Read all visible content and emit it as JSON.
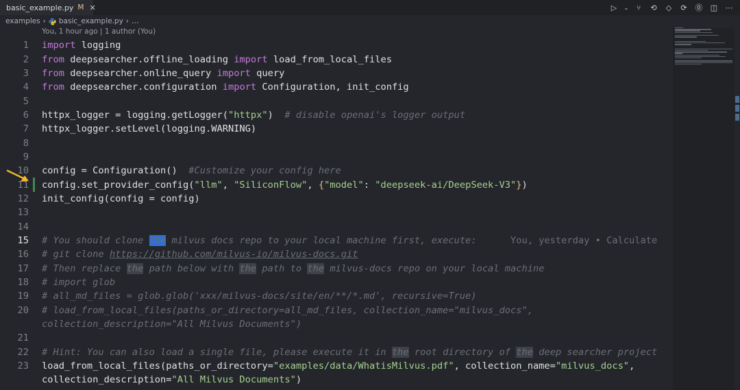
{
  "tab": {
    "filename": "basic_example.py",
    "modified": "M",
    "close": "✕"
  },
  "breadcrumb": {
    "folder": "examples",
    "file": "basic_example.py",
    "ellipsis": "…"
  },
  "blame_header": "You, 1 hour ago | 1 author (You)",
  "code": {
    "lines": [
      {
        "n": "1",
        "tokens": [
          {
            "t": "kw",
            "v": "import"
          },
          {
            "t": "txt",
            "v": " logging"
          }
        ]
      },
      {
        "n": "2",
        "tokens": [
          {
            "t": "kw",
            "v": "from"
          },
          {
            "t": "txt",
            "v": " deepsearcher.offline_loading "
          },
          {
            "t": "kw",
            "v": "import"
          },
          {
            "t": "txt",
            "v": " load_from_local_files"
          }
        ]
      },
      {
        "n": "3",
        "tokens": [
          {
            "t": "kw",
            "v": "from"
          },
          {
            "t": "txt",
            "v": " deepsearcher.online_query "
          },
          {
            "t": "kw",
            "v": "import"
          },
          {
            "t": "txt",
            "v": " query"
          }
        ]
      },
      {
        "n": "4",
        "tokens": [
          {
            "t": "kw",
            "v": "from"
          },
          {
            "t": "txt",
            "v": " deepsearcher.configuration "
          },
          {
            "t": "kw",
            "v": "import"
          },
          {
            "t": "txt",
            "v": " Configuration, init_config"
          }
        ]
      },
      {
        "n": "5",
        "tokens": []
      },
      {
        "n": "6",
        "tokens": [
          {
            "t": "txt",
            "v": "httpx_logger = logging.getLogger("
          },
          {
            "t": "str",
            "v": "\"httpx\""
          },
          {
            "t": "txt",
            "v": ")  "
          },
          {
            "t": "cm",
            "v": "# disable openai's logger output"
          }
        ]
      },
      {
        "n": "7",
        "tokens": [
          {
            "t": "txt",
            "v": "httpx_logger.setLevel(logging.WARNING)"
          }
        ]
      },
      {
        "n": "8",
        "tokens": []
      },
      {
        "n": "9",
        "tokens": []
      },
      {
        "n": "10",
        "tokens": [
          {
            "t": "txt",
            "v": "config = Configuration()  "
          },
          {
            "t": "cm",
            "v": "#Customize your config here"
          }
        ]
      },
      {
        "n": "11",
        "mod": true,
        "tokens": [
          {
            "t": "txt",
            "v": "config.set_provider_config("
          },
          {
            "t": "str",
            "v": "\"llm\""
          },
          {
            "t": "txt",
            "v": ", "
          },
          {
            "t": "str",
            "v": "\"SiliconFlow\""
          },
          {
            "t": "txt",
            "v": ", "
          },
          {
            "t": "brace",
            "v": "{"
          },
          {
            "t": "str",
            "v": "\"model\""
          },
          {
            "t": "txt",
            "v": ": "
          },
          {
            "t": "str",
            "v": "\"deepseek-ai/DeepSeek-V3\""
          },
          {
            "t": "brace",
            "v": "}"
          },
          {
            "t": "txt",
            "v": ")"
          }
        ]
      },
      {
        "n": "12",
        "tokens": [
          {
            "t": "txt",
            "v": "init_config(config = config)"
          }
        ]
      },
      {
        "n": "13",
        "tokens": []
      },
      {
        "n": "14",
        "tokens": []
      },
      {
        "n": "15",
        "active": true,
        "tokens": [
          {
            "t": "cm",
            "v": "# You should clone "
          },
          {
            "t": "cursor",
            "v": "the"
          },
          {
            "t": "cm",
            "v": " milvus docs repo to your local machine first, execute:"
          },
          {
            "t": "blame",
            "v": "      You, yesterday • Calculate"
          }
        ]
      },
      {
        "n": "16",
        "tokens": [
          {
            "t": "cm",
            "v": "# git clone "
          },
          {
            "t": "link",
            "v": "https://github.com/milvus-io/milvus-docs.git"
          }
        ]
      },
      {
        "n": "17",
        "tokens": [
          {
            "t": "cm",
            "v": "# Then replace "
          },
          {
            "t": "cmh",
            "v": "the"
          },
          {
            "t": "cm",
            "v": " path below with "
          },
          {
            "t": "cmh",
            "v": "the"
          },
          {
            "t": "cm",
            "v": " path to "
          },
          {
            "t": "cmh",
            "v": "the"
          },
          {
            "t": "cm",
            "v": " milvus-docs repo on your local machine"
          }
        ]
      },
      {
        "n": "18",
        "tokens": [
          {
            "t": "cm",
            "v": "# import glob"
          }
        ]
      },
      {
        "n": "19",
        "tokens": [
          {
            "t": "cm",
            "v": "# all_md_files = glob.glob('xxx/milvus-docs/site/en/**/*.md', recursive=True)"
          }
        ]
      },
      {
        "n": "20",
        "tokens": [
          {
            "t": "cm",
            "v": "# load_from_local_files(paths_or_directory=all_md_files, collection_name=\"milvus_docs\","
          }
        ]
      },
      {
        "n": "",
        "tokens": [
          {
            "t": "cm",
            "v": "collection_description=\"All Milvus Documents\")"
          }
        ]
      },
      {
        "n": "21",
        "tokens": []
      },
      {
        "n": "22",
        "tokens": [
          {
            "t": "cm",
            "v": "# Hint: You can also load a single file, please execute it in "
          },
          {
            "t": "cmh",
            "v": "the"
          },
          {
            "t": "cm",
            "v": " root directory of "
          },
          {
            "t": "cmh",
            "v": "the"
          },
          {
            "t": "cm",
            "v": " deep searcher project"
          }
        ]
      },
      {
        "n": "23",
        "tokens": [
          {
            "t": "txt",
            "v": "load_from_local_files(paths_or_directory="
          },
          {
            "t": "str",
            "v": "\"examples/data/WhatisMilvus.pdf\""
          },
          {
            "t": "txt",
            "v": ", collection_name="
          },
          {
            "t": "str",
            "v": "\"milvus_docs\""
          },
          {
            "t": "txt",
            "v": ","
          }
        ]
      },
      {
        "n": "",
        "tokens": [
          {
            "t": "txt",
            "v": "collection_description="
          },
          {
            "t": "str",
            "v": "\"All Milvus Documents\""
          },
          {
            "t": "txt",
            "v": ")"
          }
        ]
      }
    ]
  },
  "colors": {
    "accent_arrow": "#f5b82e",
    "keyword": "#c678dd",
    "string": "#a6d18f",
    "comment": "#6b6f77",
    "cursor": "#2f6fd6",
    "git_modified": "#3f8b4a"
  },
  "icons": [
    "run-icon",
    "chevron-down-icon",
    "source-control-icon",
    "go-back-icon",
    "go-forward-icon",
    "open-changes-icon",
    "git-graph-icon",
    "split-editor-icon",
    "more-icon"
  ]
}
